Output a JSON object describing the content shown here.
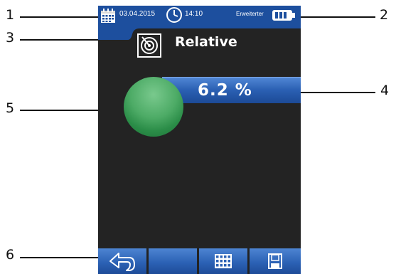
{
  "callouts": {
    "n1": "1",
    "n2": "2",
    "n3": "3",
    "n4": "4",
    "n5": "5",
    "n6": "6"
  },
  "status_bar": {
    "date": "03.04.2015",
    "time": "14:10",
    "mode_label": "Erweiterter",
    "icons": [
      "calendar-icon",
      "clock-icon",
      "battery-icon"
    ]
  },
  "header": {
    "title": "Relative",
    "icon": "radar-icon"
  },
  "reading": {
    "value_text": "6.2 %",
    "indicator_color": "#2f9a4f"
  },
  "bottom_nav": {
    "buttons": [
      "back-icon",
      "blank",
      "grid-icon",
      "save-icon"
    ]
  },
  "colors": {
    "accent": "#1d4f9e",
    "screen_background": "#232323",
    "indicator_green": "#2f9a4f"
  }
}
